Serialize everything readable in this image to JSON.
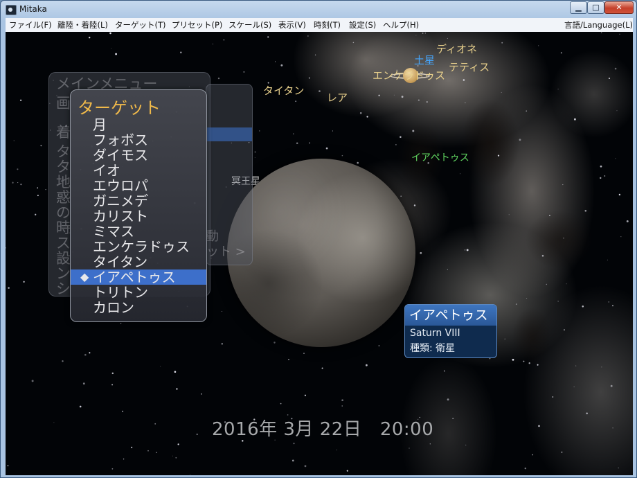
{
  "window": {
    "title": "Mitaka",
    "controls": {
      "minimize": "▁",
      "maximize": "□",
      "close": "✕"
    }
  },
  "menubar": {
    "items": [
      "ファイル(F)",
      "離陸・着陸(L)",
      "ターゲット(T)",
      "プリセット(P)",
      "スケール(S)",
      "表示(V)",
      "時刻(T)",
      "設定(S)",
      "ヘルプ(H)"
    ],
    "language": "言語/Language(L)"
  },
  "sky_labels": {
    "saturn": "土星",
    "dione": "ディオネ",
    "tethys": "テティス",
    "enceladus": "エンケラドゥス",
    "titan": "タイタン",
    "rhea": "レア",
    "iapetus": "イアペトゥス",
    "pluto_partial": "冥王星"
  },
  "main_menu_ghost": {
    "title": "メインメニュー",
    "fragments": [
      "画",
      "着",
      "タ",
      "タ",
      "地",
      "惑",
      "の",
      "時",
      "ス",
      "設",
      "ン",
      "シ"
    ],
    "submenu_fragments": [
      "動",
      "ット >"
    ]
  },
  "target_menu": {
    "title": "ターゲット",
    "items": [
      {
        "label": "月",
        "selected": false
      },
      {
        "label": "フォボス",
        "selected": false
      },
      {
        "label": "ダイモス",
        "selected": false
      },
      {
        "label": "イオ",
        "selected": false
      },
      {
        "label": "エウロパ",
        "selected": false
      },
      {
        "label": "ガニメデ",
        "selected": false
      },
      {
        "label": "カリスト",
        "selected": false
      },
      {
        "label": "ミマス",
        "selected": false
      },
      {
        "label": "エンケラドゥス",
        "selected": false
      },
      {
        "label": "タイタン",
        "selected": false
      },
      {
        "label": "イアペトゥス",
        "selected": true
      },
      {
        "label": "トリトン",
        "selected": false
      },
      {
        "label": "カロン",
        "selected": false
      }
    ],
    "selected_marker": "◆"
  },
  "info_box": {
    "title": "イアペトゥス",
    "designation": "Saturn VIII",
    "type": "種類: 衛星"
  },
  "datetime": "2016年 3月 22日　20:00",
  "colors": {
    "menu_highlight": "#3d6fca",
    "menu_title": "#f0b94a",
    "label_gold": "#e8d08c",
    "label_green": "#5fd35f",
    "label_cyan": "#45a7ff"
  }
}
